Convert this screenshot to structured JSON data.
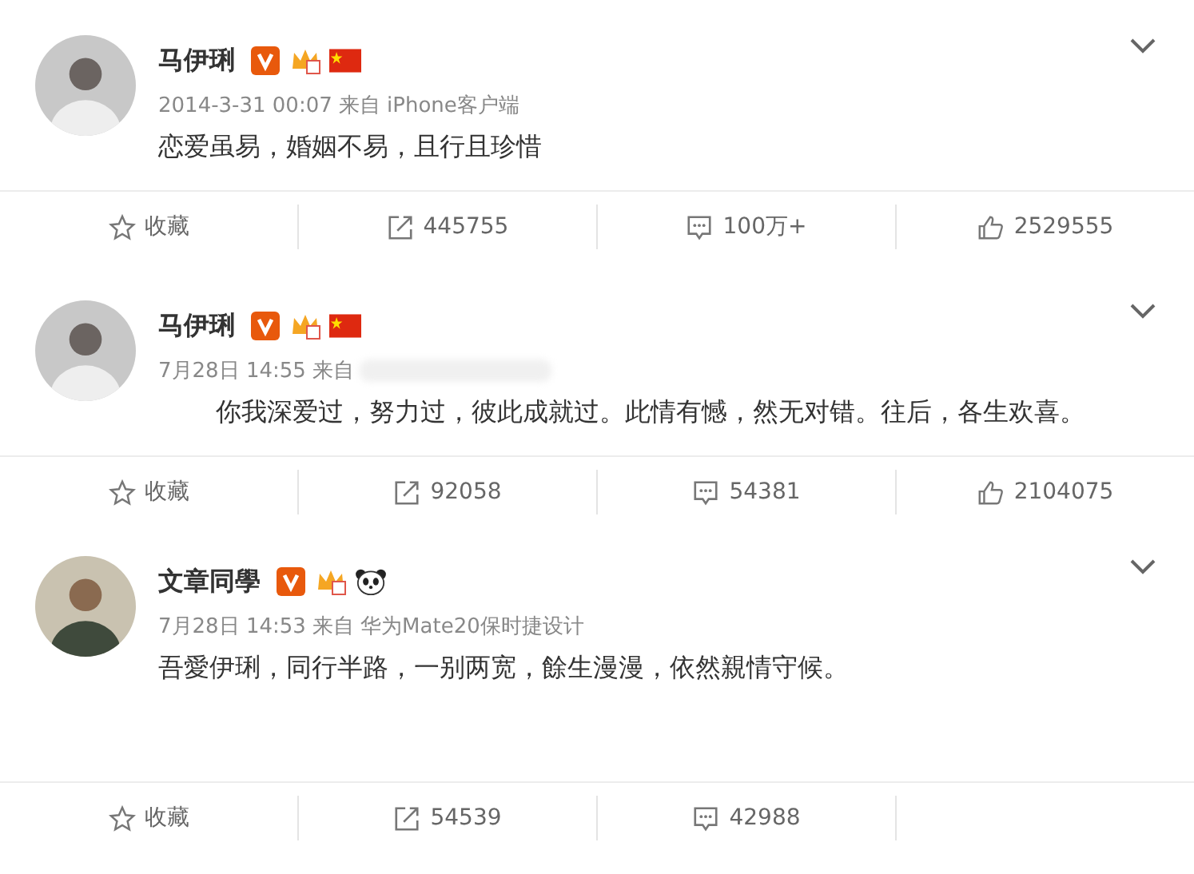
{
  "posts": [
    {
      "author": "马伊琍",
      "badges": [
        {
          "kind": "verified"
        },
        {
          "kind": "crown"
        },
        {
          "kind": "flag"
        }
      ],
      "time": "2014-3-31 00:07",
      "source": "来自 iPhone客户端",
      "source_blurred": false,
      "text": "恋爱虽易，婚姻不易，且行且珍惜",
      "indented": false,
      "actions": {
        "favorite": "收藏",
        "reposts": "445755",
        "comments": "100万+",
        "likes": "2529555"
      }
    },
    {
      "author": "马伊琍",
      "badges": [
        {
          "kind": "verified"
        },
        {
          "kind": "crown"
        },
        {
          "kind": "flag"
        }
      ],
      "time": "7月28日 14:55",
      "source": "来自",
      "source_blurred": true,
      "text": "你我深爱过，努力过，彼此成就过。此情有憾，然无对错。往后，各生欢喜。",
      "indented": true,
      "actions": {
        "favorite": "收藏",
        "reposts": "92058",
        "comments": "54381",
        "likes": "2104075"
      }
    },
    {
      "author": "文章同學",
      "badges": [
        {
          "kind": "verified"
        },
        {
          "kind": "crown"
        },
        {
          "kind": "panda"
        }
      ],
      "time": "7月28日 14:53",
      "source": "来自 华为Mate20保时捷设计",
      "source_blurred": false,
      "text": "吾愛伊琍，同行半路，一别两宽，餘生漫漫，依然親情守候。",
      "indented": false,
      "actions": {
        "favorite": "收藏",
        "reposts": "54539",
        "comments": "42988"
      }
    }
  ]
}
